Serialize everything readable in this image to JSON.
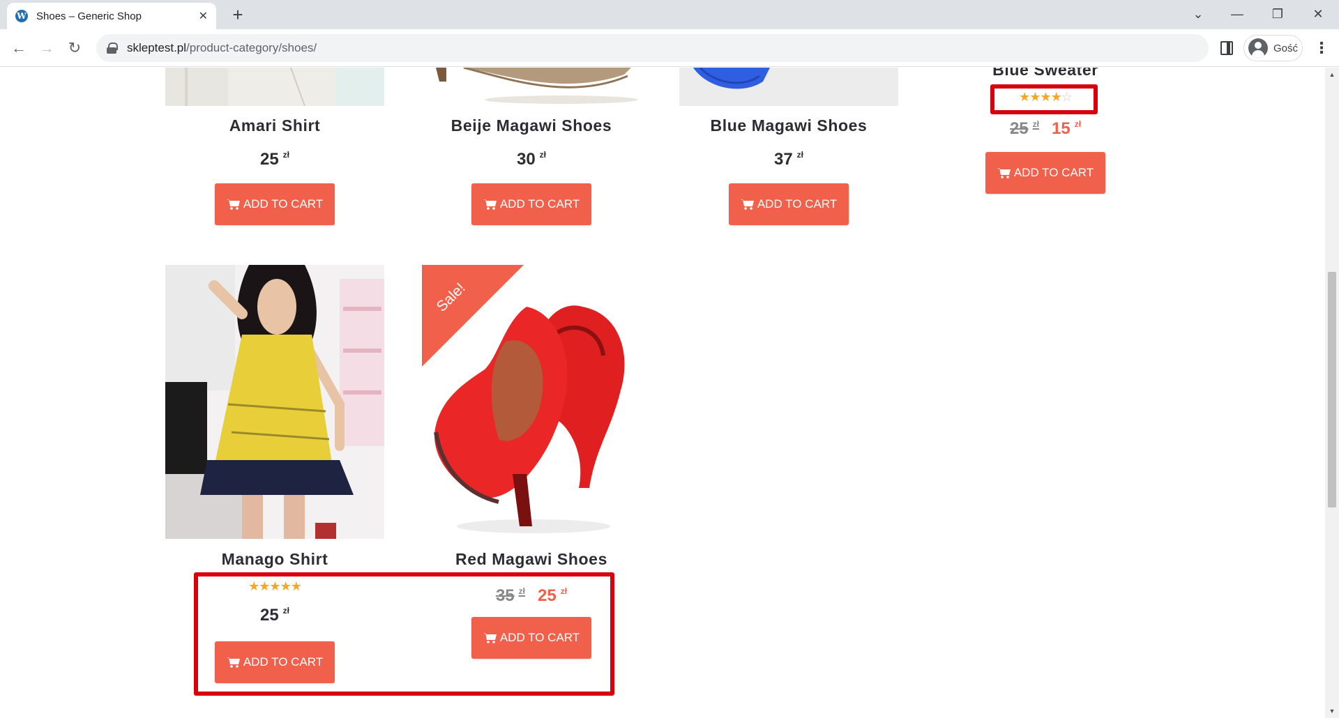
{
  "browser": {
    "tab_title": "Shoes – Generic Shop",
    "favicon_letter": "W",
    "new_tab": "+",
    "url_domain": "skleptest.pl",
    "url_path": "/product-category/shoes/",
    "profile_name": "Gość",
    "window_controls": {
      "tabs_menu": "⌄",
      "minimize": "—",
      "restore": "❐",
      "close": "✕"
    }
  },
  "colors": {
    "accent": "#f0604a",
    "highlight_border": "#d9000d",
    "star": "#f5a623"
  },
  "products": [
    {
      "title": "Amari Shirt",
      "price": "25",
      "currency": "zł",
      "button": "ADD TO CART"
    },
    {
      "title": "Beije Magawi Shoes",
      "price": "30",
      "currency": "zł",
      "button": "ADD TO CART"
    },
    {
      "title": "Blue Magawi Shoes",
      "price": "37",
      "currency": "zł",
      "button": "ADD TO CART"
    },
    {
      "title": "Blue Sweater",
      "old_price": "25",
      "new_price": "15",
      "currency": "zł",
      "rating": 4,
      "rating_max": 5,
      "button": "ADD TO CART"
    },
    {
      "title": "Manago Shirt",
      "price": "25",
      "currency": "zł",
      "rating": 5,
      "rating_max": 5,
      "button": "ADD TO CART"
    },
    {
      "title": "Red Magawi Shoes",
      "old_price": "35",
      "new_price": "25",
      "currency": "zł",
      "sale_badge": "Sale!",
      "button": "ADD TO CART"
    }
  ]
}
